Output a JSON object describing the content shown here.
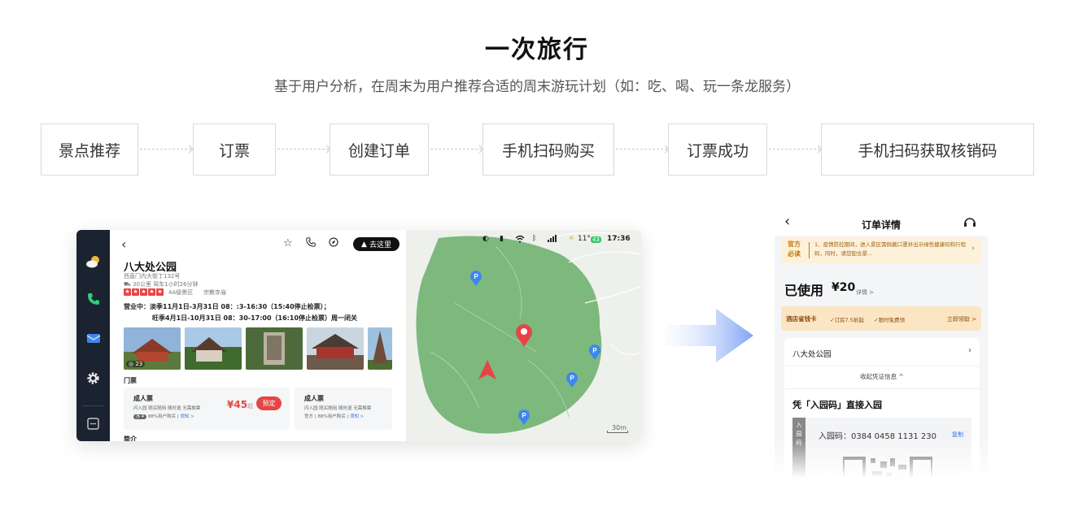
{
  "page": {
    "title": "一次旅行",
    "subtitle": "基于用户分析，在周末为用户推荐合适的周末游玩计划（如：吃、喝、玩一条龙服务）"
  },
  "flow": [
    "景点推荐",
    "订票",
    "创建订单",
    "手机扫码购买",
    "订票成功",
    "手机扫码获取核销码"
  ],
  "car": {
    "go_button": "去这里",
    "poi_name": "八大处公园",
    "address": "西直门内大街丁132号",
    "distance": "30公里 驾车1小时26分钟",
    "level": "4A级景区",
    "category": "宗教寺庙",
    "hours_line1": "营业中：淡季11月1日-3月31日 08：:3-16:30（15:40停止检票）；",
    "hours_line2": "旺季4月1日-10月31日 08：30-17:00（16:10停止检票）周一闭关",
    "photo_count": "23",
    "section_ticket": "门票",
    "tickets": [
      {
        "name": "成人票",
        "tags": "闪入园  随买随用  随时退  无需换票",
        "count": "4",
        "meta": "88%用户购买",
        "notice": "须知 >",
        "price": "¥45",
        "price_suffix": "起",
        "button": "预定"
      },
      {
        "name": "成人票",
        "tags": "闪入园  随买随用  随时退  无需换票",
        "meta": "官方 | 88%用户购买",
        "notice": "须知 >"
      }
    ],
    "section_intro": "简介",
    "status_temp": "11°",
    "status_aqi": "43",
    "status_time": "17:36",
    "map_scale": "30m",
    "parking_label": "P",
    "colors": {
      "sidebar": "#1b2330",
      "accent": "#e64545",
      "map_park": "#7db87d"
    }
  },
  "phone": {
    "title": "订单详情",
    "notice_tag": "官方必读",
    "notice_text": "1、疫情防控期间，进入景区需佩戴口罩并出示绿色健康码和行程码，同时，请您配合景...",
    "status": "已使用",
    "price": "¥20",
    "detail": "详情 >",
    "hotel_name": "酒店省钱卡",
    "hotel_f1": "✓订房7.5折起",
    "hotel_f2": "✓限时免费领",
    "hotel_action": "立即领取 >",
    "poi": "八大处公园",
    "collapse": "收起凭证信息 ^",
    "enter_label": "凭「入园码」直接入园",
    "code_label": "入园码",
    "code_value": "入园码：0384 0458 1131 230",
    "copy": "复制"
  }
}
